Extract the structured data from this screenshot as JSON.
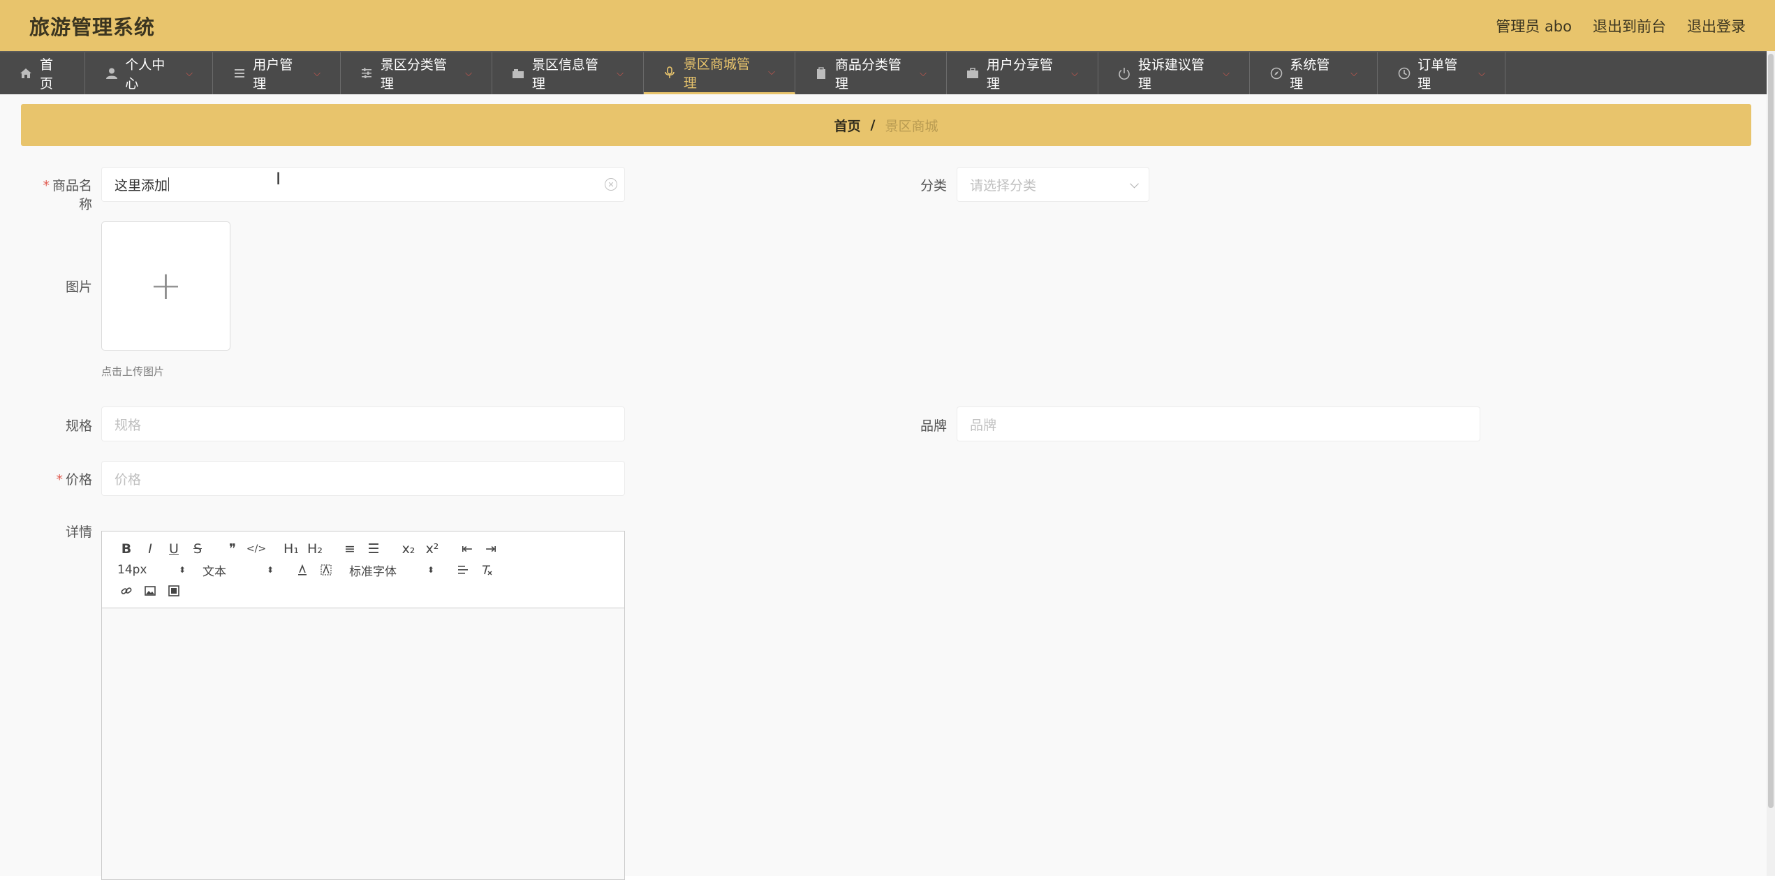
{
  "header": {
    "title": "旅游管理系统",
    "user_label": "管理员 abo",
    "to_front": "退出到前台",
    "logout": "退出登录"
  },
  "nav": {
    "items": [
      {
        "label": "首页",
        "icon": "home-icon"
      },
      {
        "label": "个人中心",
        "icon": "user-icon"
      },
      {
        "label": "用户管理",
        "icon": "list-icon"
      },
      {
        "label": "景区分类管理",
        "icon": "sliders-icon"
      },
      {
        "label": "景区信息管理",
        "icon": "camera-icon"
      },
      {
        "label": "景区商城管理",
        "icon": "microphone-icon"
      },
      {
        "label": "商品分类管理",
        "icon": "clipboard-icon"
      },
      {
        "label": "用户分享管理",
        "icon": "briefcase-icon"
      },
      {
        "label": "投诉建议管理",
        "icon": "power-icon"
      },
      {
        "label": "系统管理",
        "icon": "compass-icon"
      },
      {
        "label": "订单管理",
        "icon": "clock-icon"
      }
    ],
    "active_index": 5,
    "accent_color": "#e8c46c"
  },
  "breadcrumb": {
    "home": "首页",
    "separator": "/",
    "current": "景区商城"
  },
  "form": {
    "name_label": "商品名称",
    "name_value": "这里添加",
    "category_label": "分类",
    "category_placeholder": "请选择分类",
    "image_label": "图片",
    "upload_tip": "点击上传图片",
    "spec_label": "规格",
    "spec_placeholder": "规格",
    "brand_label": "品牌",
    "brand_placeholder": "品牌",
    "price_label": "价格",
    "price_placeholder": "价格",
    "detail_label": "详情",
    "required_mark": "*"
  },
  "editor": {
    "font_size": "14px",
    "header_picker": "文本",
    "font_picker": "标准字体",
    "buttons_row1": [
      "B",
      "I",
      "U",
      "S",
      "❞",
      "</>",
      "H₁",
      "H₂",
      "≡",
      "☰",
      "x₂",
      "x²",
      "⇤",
      "⇥"
    ],
    "picker_arrows": "⬍"
  },
  "colors": {
    "header_bg": "#e8c46c",
    "nav_bg": "#4a4a4a",
    "required": "#e05a4f"
  }
}
